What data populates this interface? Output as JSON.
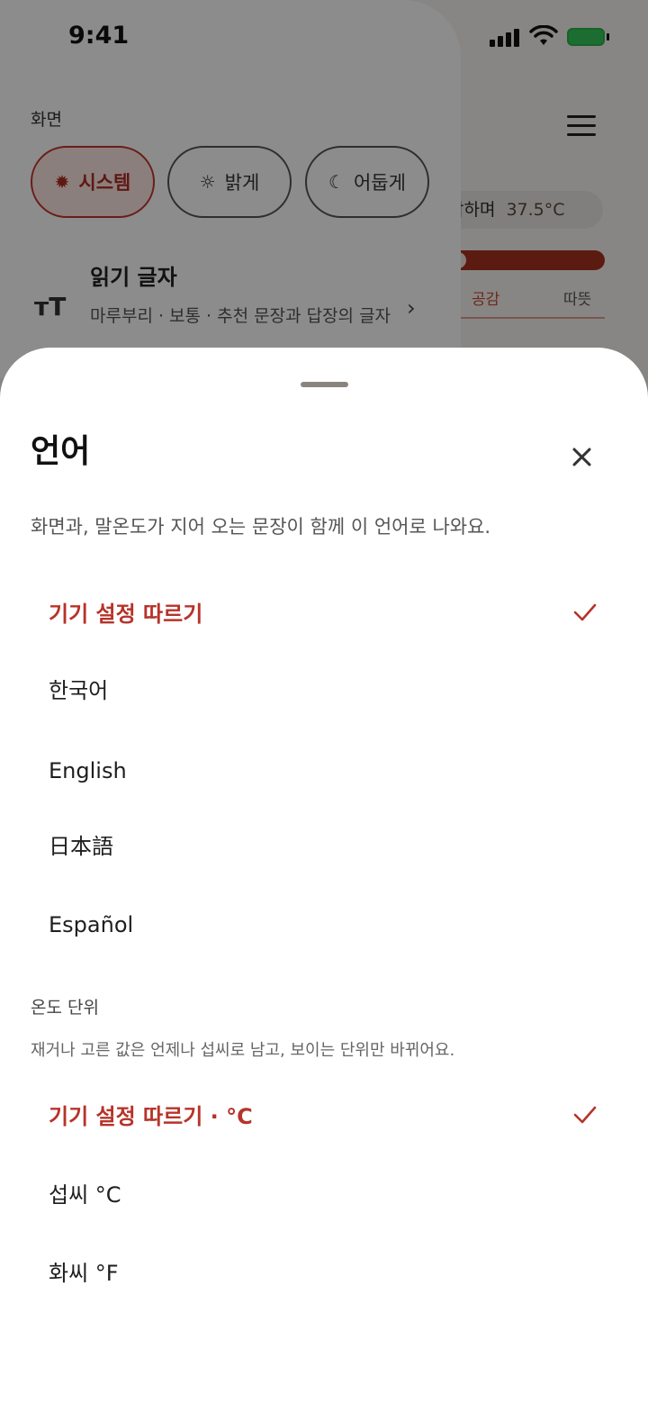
{
  "status_bar": {
    "time": "9:41"
  },
  "background": {
    "temperature_label": "감하며",
    "temperature_value": "37.5°C",
    "meter_labels": [
      "공감",
      "따뜻"
    ]
  },
  "drawer": {
    "section_title": "화면",
    "theme_options": [
      {
        "label": "시스템",
        "icon": "auto-icon",
        "selected": true
      },
      {
        "label": "밝게",
        "icon": "sun-icon",
        "selected": false
      },
      {
        "label": "어둡게",
        "icon": "moon-icon",
        "selected": false
      }
    ],
    "reading_font": {
      "title": "읽기 글자",
      "subtitle": "마루부리 · 보통 · 추천 문장과 답장의 글자"
    }
  },
  "sheet": {
    "title": "언어",
    "description": "화면과, 말온도가 지어 오는 문장이 함께 이 언어로 나와요.",
    "languages": [
      {
        "label": "기기 설정 따르기",
        "selected": true
      },
      {
        "label": "한국어",
        "selected": false
      },
      {
        "label": "English",
        "selected": false
      },
      {
        "label": "日本語",
        "selected": false
      },
      {
        "label": "Español",
        "selected": false
      }
    ],
    "temperature_section": {
      "title": "온도 단위",
      "description": "재거나 고른 값은 언제나 섭씨로 남고, 보이는 단위만 바뀌어요.",
      "options": [
        {
          "label": "기기 설정 따르기 · °C",
          "selected": true
        },
        {
          "label": "섭씨 °C",
          "selected": false
        },
        {
          "label": "화씨 °F",
          "selected": false
        }
      ]
    }
  },
  "colors": {
    "accent": "#b7332a",
    "meter": "#a8321f"
  }
}
